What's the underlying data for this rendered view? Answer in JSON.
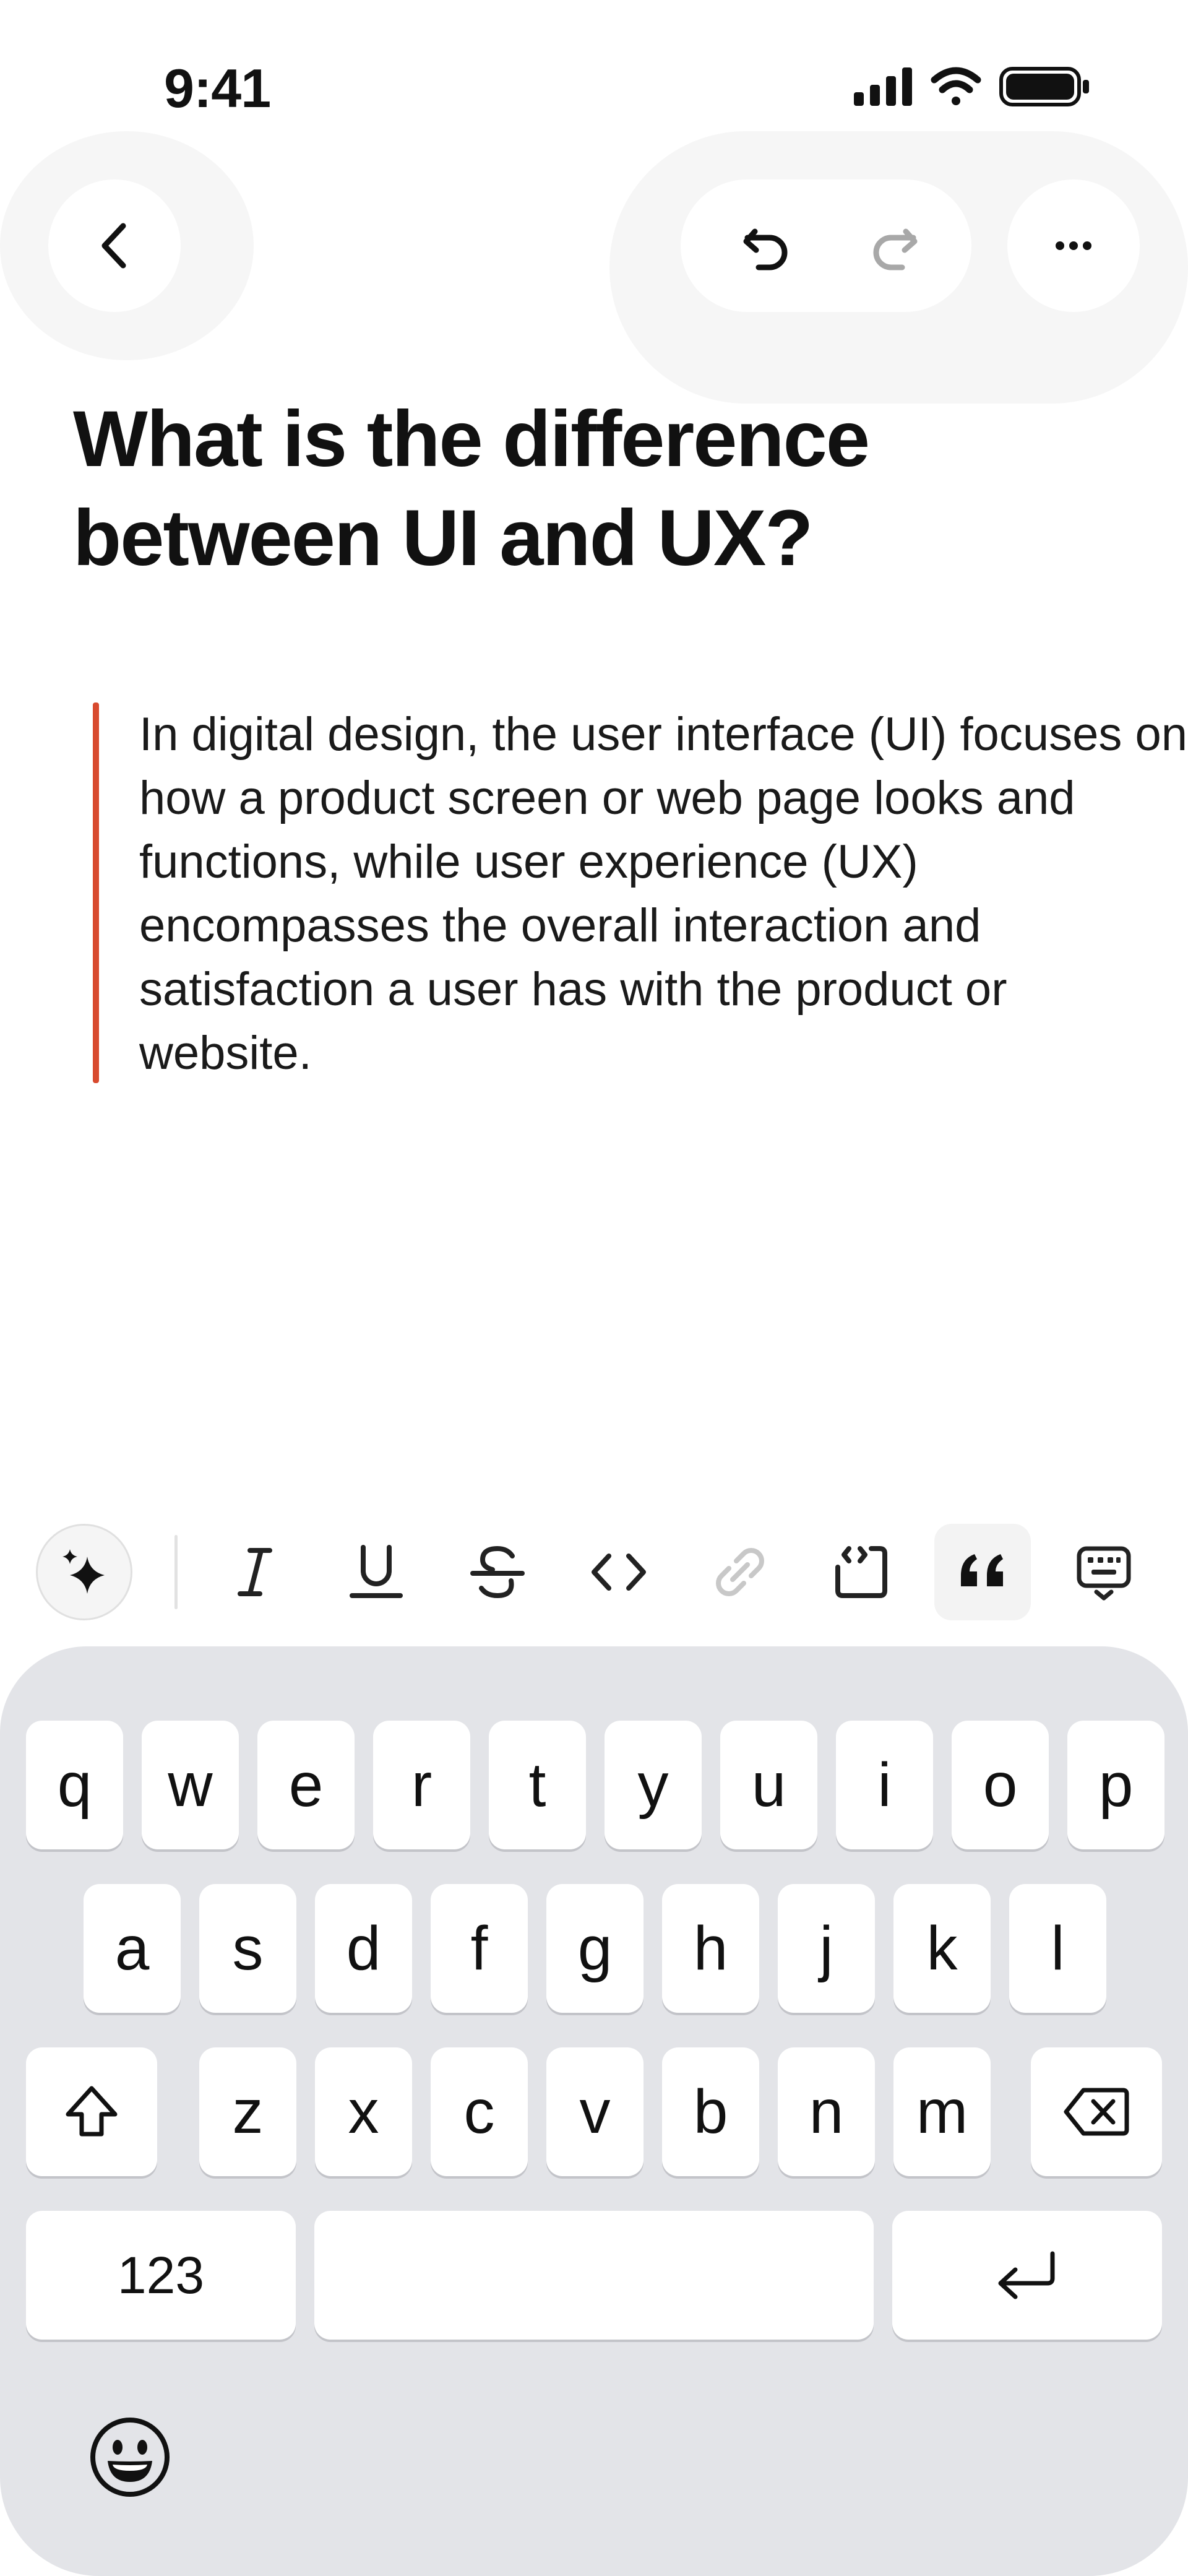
{
  "status_bar": {
    "time": "9:41",
    "icons": [
      "cellular-signal-icon",
      "wifi-icon",
      "battery-icon"
    ]
  },
  "nav": {
    "back_icon": "chevron-left-icon",
    "undo_icon": "undo-icon",
    "redo_icon": "redo-icon",
    "more_icon": "ellipsis-icon"
  },
  "note": {
    "title": "What is the difference between UI and UX?",
    "quote": "In digital design, the user interface (UI) focuses on how a product screen or web page looks and functions, while user experience (UX) encompasses the overall interaction and satisfaction a user has with the product or website."
  },
  "toolbar": {
    "items": [
      {
        "name": "ai-sparkle-icon",
        "state": "normal"
      },
      {
        "name": "italic-icon",
        "state": "normal"
      },
      {
        "name": "underline-icon",
        "state": "normal"
      },
      {
        "name": "strikethrough-icon",
        "state": "normal"
      },
      {
        "name": "code-icon",
        "state": "normal"
      },
      {
        "name": "link-icon",
        "state": "disabled"
      },
      {
        "name": "code-block-icon",
        "state": "normal"
      },
      {
        "name": "quote-icon",
        "state": "active"
      },
      {
        "name": "keyboard-dismiss-icon",
        "state": "normal"
      }
    ]
  },
  "keyboard": {
    "row1": [
      "q",
      "w",
      "e",
      "r",
      "t",
      "y",
      "u",
      "i",
      "o",
      "p"
    ],
    "row2": [
      "a",
      "s",
      "d",
      "f",
      "g",
      "h",
      "j",
      "k",
      "l"
    ],
    "row3": [
      "z",
      "x",
      "c",
      "v",
      "b",
      "n",
      "m"
    ],
    "numbers_label": "123",
    "shift_icon": "shift-icon",
    "delete_icon": "delete-backspace-icon",
    "return_icon": "return-icon",
    "emoji_icon": "emoji-icon"
  },
  "colors": {
    "quote_accent": "#d84a2e",
    "keyboard_bg": "#e3e4e8",
    "disabled_icon": "#c8c8c8",
    "redo_icon": "#a8a8a8"
  }
}
